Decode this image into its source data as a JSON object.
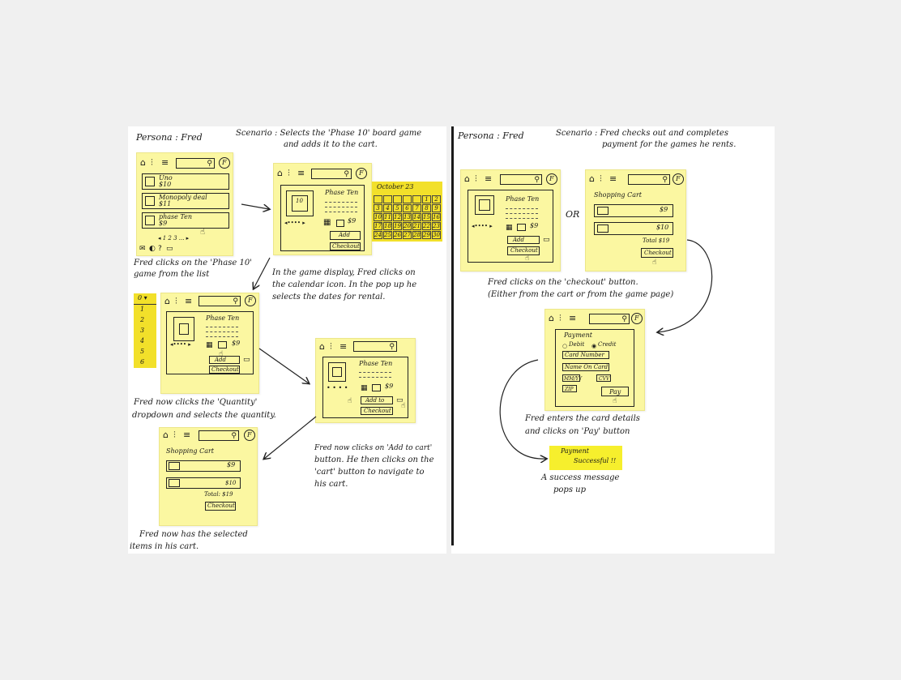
{
  "left_panel": {
    "persona": "Persona : Fred",
    "scenario_line1": "Scenario : Selects the 'Phase 10' board game",
    "scenario_line2": "and adds it to the cart.",
    "list_screen": {
      "search_icon": "search-icon",
      "profile_letter": "F",
      "items": [
        {
          "name": "Uno",
          "price": "$10"
        },
        {
          "name": "Monopoly deal",
          "price": "$11"
        },
        {
          "name": "phase Ten",
          "price": "$9"
        }
      ],
      "pagination": "◂ 1 2 3 ... ▸"
    },
    "caption1": [
      "Fred clicks on the 'Phase 10'",
      "game from the list"
    ],
    "game_screen": {
      "title": "Phase Ten",
      "box_label": "10",
      "price": "$9",
      "add_label": "Add",
      "checkout_label": "Checkout"
    },
    "calendar": {
      "month": "October 23",
      "days": [
        "",
        "",
        "",
        "",
        "",
        "1",
        "2",
        "3",
        "4",
        "5",
        "6",
        "7",
        "8",
        "9",
        "10",
        "11",
        "12",
        "13",
        "14",
        "15",
        "16",
        "17",
        "18",
        "19",
        "20",
        "21",
        "22",
        "23",
        "24",
        "25",
        "26",
        "27",
        "28",
        "29",
        "30"
      ]
    },
    "caption2": [
      "In the game display, Fred clicks on",
      "the calendar icon. In the pop up he",
      "selects the dates for rental."
    ],
    "quantity": {
      "header": "0 ▾",
      "options": [
        "1",
        "2",
        "3",
        "4",
        "5",
        "6"
      ]
    },
    "game_screen2": {
      "title": "Phase Ten",
      "price": "$9",
      "add_label": "Add",
      "checkout_label": "Checkout"
    },
    "caption3": [
      "Fred now clicks the 'Quantity'",
      "dropdown and selects the quantity."
    ],
    "game_screen3": {
      "title": "Phase Ten",
      "price": "$9",
      "add_label": "Add to",
      "checkout_label": "Checkout"
    },
    "caption4": [
      "Fred now clicks on 'Add to cart'",
      "button. He then clicks on the",
      "'cart' button to navigate to",
      "his cart."
    ],
    "cart_screen": {
      "title": "Shopping Cart",
      "item1_price": "$9",
      "item2_price": "$10",
      "total": "Total: $19",
      "checkout_label": "Checkout"
    },
    "caption5": [
      "Fred now has the selected",
      "items in his cart."
    ]
  },
  "right_panel": {
    "persona": "Persona : Fred",
    "scenario_line1": "Scenario : Fred checks out and completes",
    "scenario_line2": "payment for the games he rents.",
    "game_screen": {
      "title": "Phase Ten",
      "price": "$9",
      "add_label": "Add",
      "checkout_label": "Checkout"
    },
    "or_label": "OR",
    "cart_screen": {
      "title": "Shopping Cart",
      "item1_price": "$9",
      "item2_price": "$10",
      "total": "Total $19",
      "checkout_label": "Checkout"
    },
    "caption1": [
      "Fred clicks on the 'checkout' button.",
      "(Either from the cart or from the game page)"
    ],
    "payment_screen": {
      "title": "Payment",
      "debit_label": "Debit",
      "credit_label": "Credit",
      "card_number": "Card Number",
      "name_on_card": "Name On Card",
      "mm_yy": "MM/YY",
      "cvv": "CVV",
      "zip": "ZIP",
      "pay_label": "Pay"
    },
    "caption2": [
      "Fred enters the card details",
      "and clicks on 'Pay' button"
    ],
    "success_message": [
      "Payment",
      "Successful !!"
    ],
    "caption3": [
      "A success message",
      "pops up"
    ]
  },
  "colors": {
    "sticky": "#fbf7a1",
    "calendar": "#f2e02a",
    "success": "#f6ef2d",
    "ink": "#222222"
  }
}
